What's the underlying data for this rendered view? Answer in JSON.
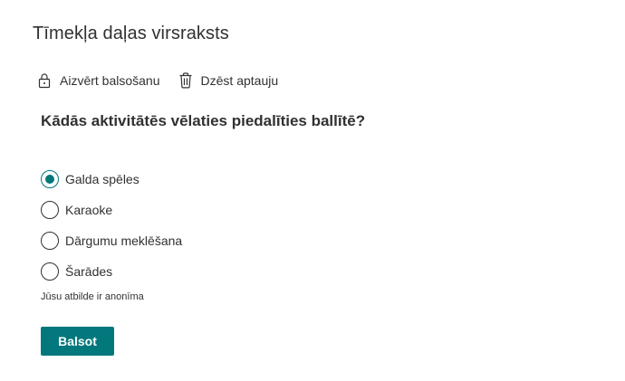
{
  "web_part": {
    "title": "Tīmekļa daļas virsraksts"
  },
  "toolbar": {
    "close_voting_label": "Aizvērt balsošanu",
    "close_voting_icon": "lock-icon",
    "delete_survey_label": "Dzēst aptauju",
    "delete_survey_icon": "trash-icon"
  },
  "poll": {
    "question": "Kādās aktivitātēs vēlaties piedalīties ballītē?",
    "options": [
      {
        "label": "Galda spēles",
        "selected": true
      },
      {
        "label": "Karaoke",
        "selected": false
      },
      {
        "label": "Dārgumu meklēšana",
        "selected": false
      },
      {
        "label": "Šarādes",
        "selected": false
      }
    ],
    "anonymous_note": "Jūsu atbilde ir anonīma",
    "vote_label": "Balsot"
  },
  "colors": {
    "accent": "#03787c",
    "text": "#323130",
    "background": "#ffffff"
  }
}
